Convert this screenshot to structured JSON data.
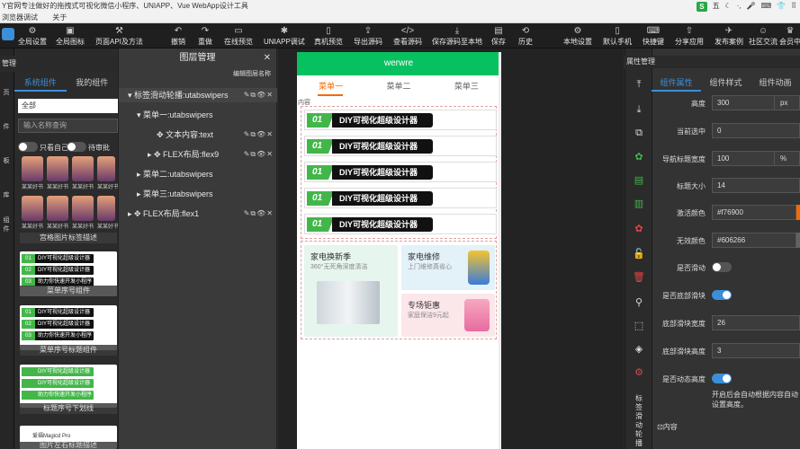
{
  "titlebar": {
    "title": "Y官网专注做好的拖拽式可视化微信小程序、UNIAPP、Vue WebApp设计工具",
    "logo": "S",
    "right_icons": [
      "五",
      "☾",
      "·,",
      "🎤",
      "⌨",
      "👕",
      "⠿"
    ]
  },
  "menubar": {
    "items": [
      "浏览器调试",
      "关于"
    ]
  },
  "toolbar": {
    "left": [
      {
        "label": "全局设置",
        "icon": "gear-icon"
      },
      {
        "label": "全局图标",
        "icon": "image-icon"
      },
      {
        "label": "页面API及方法",
        "icon": "code-icon"
      }
    ],
    "center": [
      {
        "label": "撤销",
        "icon": "undo-icon"
      },
      {
        "label": "重做",
        "icon": "redo-icon"
      },
      {
        "label": "在线预览",
        "icon": "preview-icon"
      },
      {
        "label": "UNIAPP调试",
        "icon": "bug-icon"
      },
      {
        "label": "真机预览",
        "icon": "phone-icon"
      },
      {
        "label": "导出源码",
        "icon": "export-icon"
      },
      {
        "label": "查看源码",
        "icon": "source-icon"
      },
      {
        "label": "保存源码至本地",
        "icon": "save-local-icon"
      },
      {
        "label": "保存",
        "icon": "save-icon"
      },
      {
        "label": "历史",
        "icon": "history-icon"
      }
    ],
    "right": [
      {
        "label": "本地设置",
        "icon": "settings-icon"
      },
      {
        "label": "默认手机",
        "icon": "mobile-icon"
      },
      {
        "label": "快捷键",
        "icon": "keyboard-icon"
      },
      {
        "label": "分享应用",
        "icon": "share-icon"
      },
      {
        "label": "发布案例",
        "icon": "publish-icon"
      },
      {
        "label": "社区交流",
        "icon": "community-icon"
      },
      {
        "label": "会员中",
        "icon": "member-icon"
      }
    ]
  },
  "left_panel": {
    "header": "管理",
    "edge_labels": [
      "页",
      "件",
      "板",
      "库",
      "组",
      "件"
    ],
    "tabs": [
      "系统组件",
      "我的组件"
    ],
    "category": "全部",
    "search_placeholder": "输入名称查询",
    "toggle1_label": "只看自己",
    "toggle2_label": "待审批",
    "thumb_captions": [
      "某某好书",
      "某某好书",
      "某某好书",
      "某某好书",
      "某某好书",
      "某某好书",
      "某某好书",
      "某某好书"
    ],
    "cards": [
      {
        "label": "宫格图片标签描述"
      },
      {
        "label": "菜单序号组件",
        "rows": [
          {
            "num": "01",
            "text": "DIY可视化超级设计器"
          },
          {
            "num": "02",
            "text": "DIY可视化超级设计器"
          },
          {
            "num": "03",
            "text": "助力你快速开发小程序"
          }
        ]
      },
      {
        "label": "菜单序号标题组件",
        "rows": [
          {
            "num": "01",
            "text": "DIY可视化超级设计器"
          },
          {
            "num": "02",
            "text": "DIY可视化超级设计器"
          },
          {
            "num": "03",
            "text": "助力你快速开发小程序"
          }
        ]
      },
      {
        "label": "标题序号下划线",
        "rows": [
          {
            "num": "",
            "text": "DIY可视化超级设计器"
          },
          {
            "num": "",
            "text": "DIY可视化超级设计器"
          },
          {
            "num": "",
            "text": "助力你快速开发小程序"
          }
        ]
      },
      {
        "label": "图片左右标题描述",
        "brand": "爱福Magicd Pro"
      }
    ]
  },
  "layer_panel": {
    "title": "图层管理",
    "subtitle": "编辑图层名称",
    "rows": [
      {
        "label": "▾ 标签滑动轮播:utabswipers",
        "acts": "✎⧉👁✕"
      },
      {
        "label": "▾ 菜单一:utabswipers",
        "acts": ""
      },
      {
        "label": "✥ 文本内容:text",
        "acts": "✎⧉👁✕"
      },
      {
        "label": "▸ ✥ FLEX布局:flex9",
        "acts": "✎⧉👁✕"
      },
      {
        "label": "▸ 菜单二:utabswipers",
        "acts": ""
      },
      {
        "label": "▸ 菜单三:utabswipers",
        "acts": ""
      },
      {
        "label": "▸ ✥ FLEX布局:flex1",
        "acts": "✎⧉👁✕"
      }
    ]
  },
  "phone": {
    "header_title": "werwre",
    "tabs": [
      "菜单一",
      "菜单二",
      "菜单三"
    ],
    "content_label": "内容",
    "items": [
      {
        "num": "01",
        "text": "DIY可视化超级设计器"
      },
      {
        "num": "01",
        "text": "DIY可视化超级设计器"
      },
      {
        "num": "01",
        "text": "DIY可视化超级设计器"
      },
      {
        "num": "01",
        "text": "DIY可视化超级设计器"
      },
      {
        "num": "01",
        "text": "DIY可视化超级设计器"
      }
    ],
    "promos": [
      {
        "title": "家电换新季",
        "sub": "360°无死角深度清洁"
      },
      {
        "title": "家电维修",
        "sub": "上门维修真省心"
      },
      {
        "title": "专场钜惠",
        "sub": "家庭保洁9元起"
      }
    ]
  },
  "right_tools": {
    "label": "标签滑动轮播",
    "icons": [
      "arrow-top-icon",
      "arrow-bottom-icon",
      "copy-icon",
      "green-1-icon",
      "green-2-icon",
      "green-3-icon",
      "red-1-icon",
      "lock-icon",
      "delete-icon",
      "pin-icon",
      "select-icon",
      "layers-icon",
      "settings-icon"
    ]
  },
  "props": {
    "header": "属性管理",
    "tabs": [
      "组件属性",
      "组件样式",
      "组件动画"
    ],
    "fields": [
      {
        "label": "高度",
        "value": "300",
        "unit": "px"
      },
      {
        "label": "当前选中",
        "value": "0",
        "unit": ""
      },
      {
        "label": "导航标题宽度",
        "value": "100",
        "unit": "%"
      },
      {
        "label": "标题大小",
        "value": "14",
        "unit": ""
      },
      {
        "label": "激活颜色",
        "value": "#f76900",
        "unit": "",
        "swatch": "#f76900"
      },
      {
        "label": "无效颜色",
        "value": "#606266",
        "unit": "",
        "swatch": "#606266"
      }
    ],
    "toggles": [
      {
        "label": "是否滑动",
        "on": false
      },
      {
        "label": "是否底部滑块",
        "on": true
      }
    ],
    "fields2": [
      {
        "label": "底部滑块宽度",
        "value": "26"
      },
      {
        "label": "底部滑块高度",
        "value": "3"
      }
    ],
    "toggle3": {
      "label": "是否动态高度",
      "on": true
    },
    "note": "开启后会自动根据内容自动设置高度。",
    "bottom_label": "⊡内容"
  },
  "colors": {
    "accent": "#3b8fd9",
    "phone_header": "#07c160",
    "tab_active": "#f76900",
    "green": "#43b649"
  }
}
